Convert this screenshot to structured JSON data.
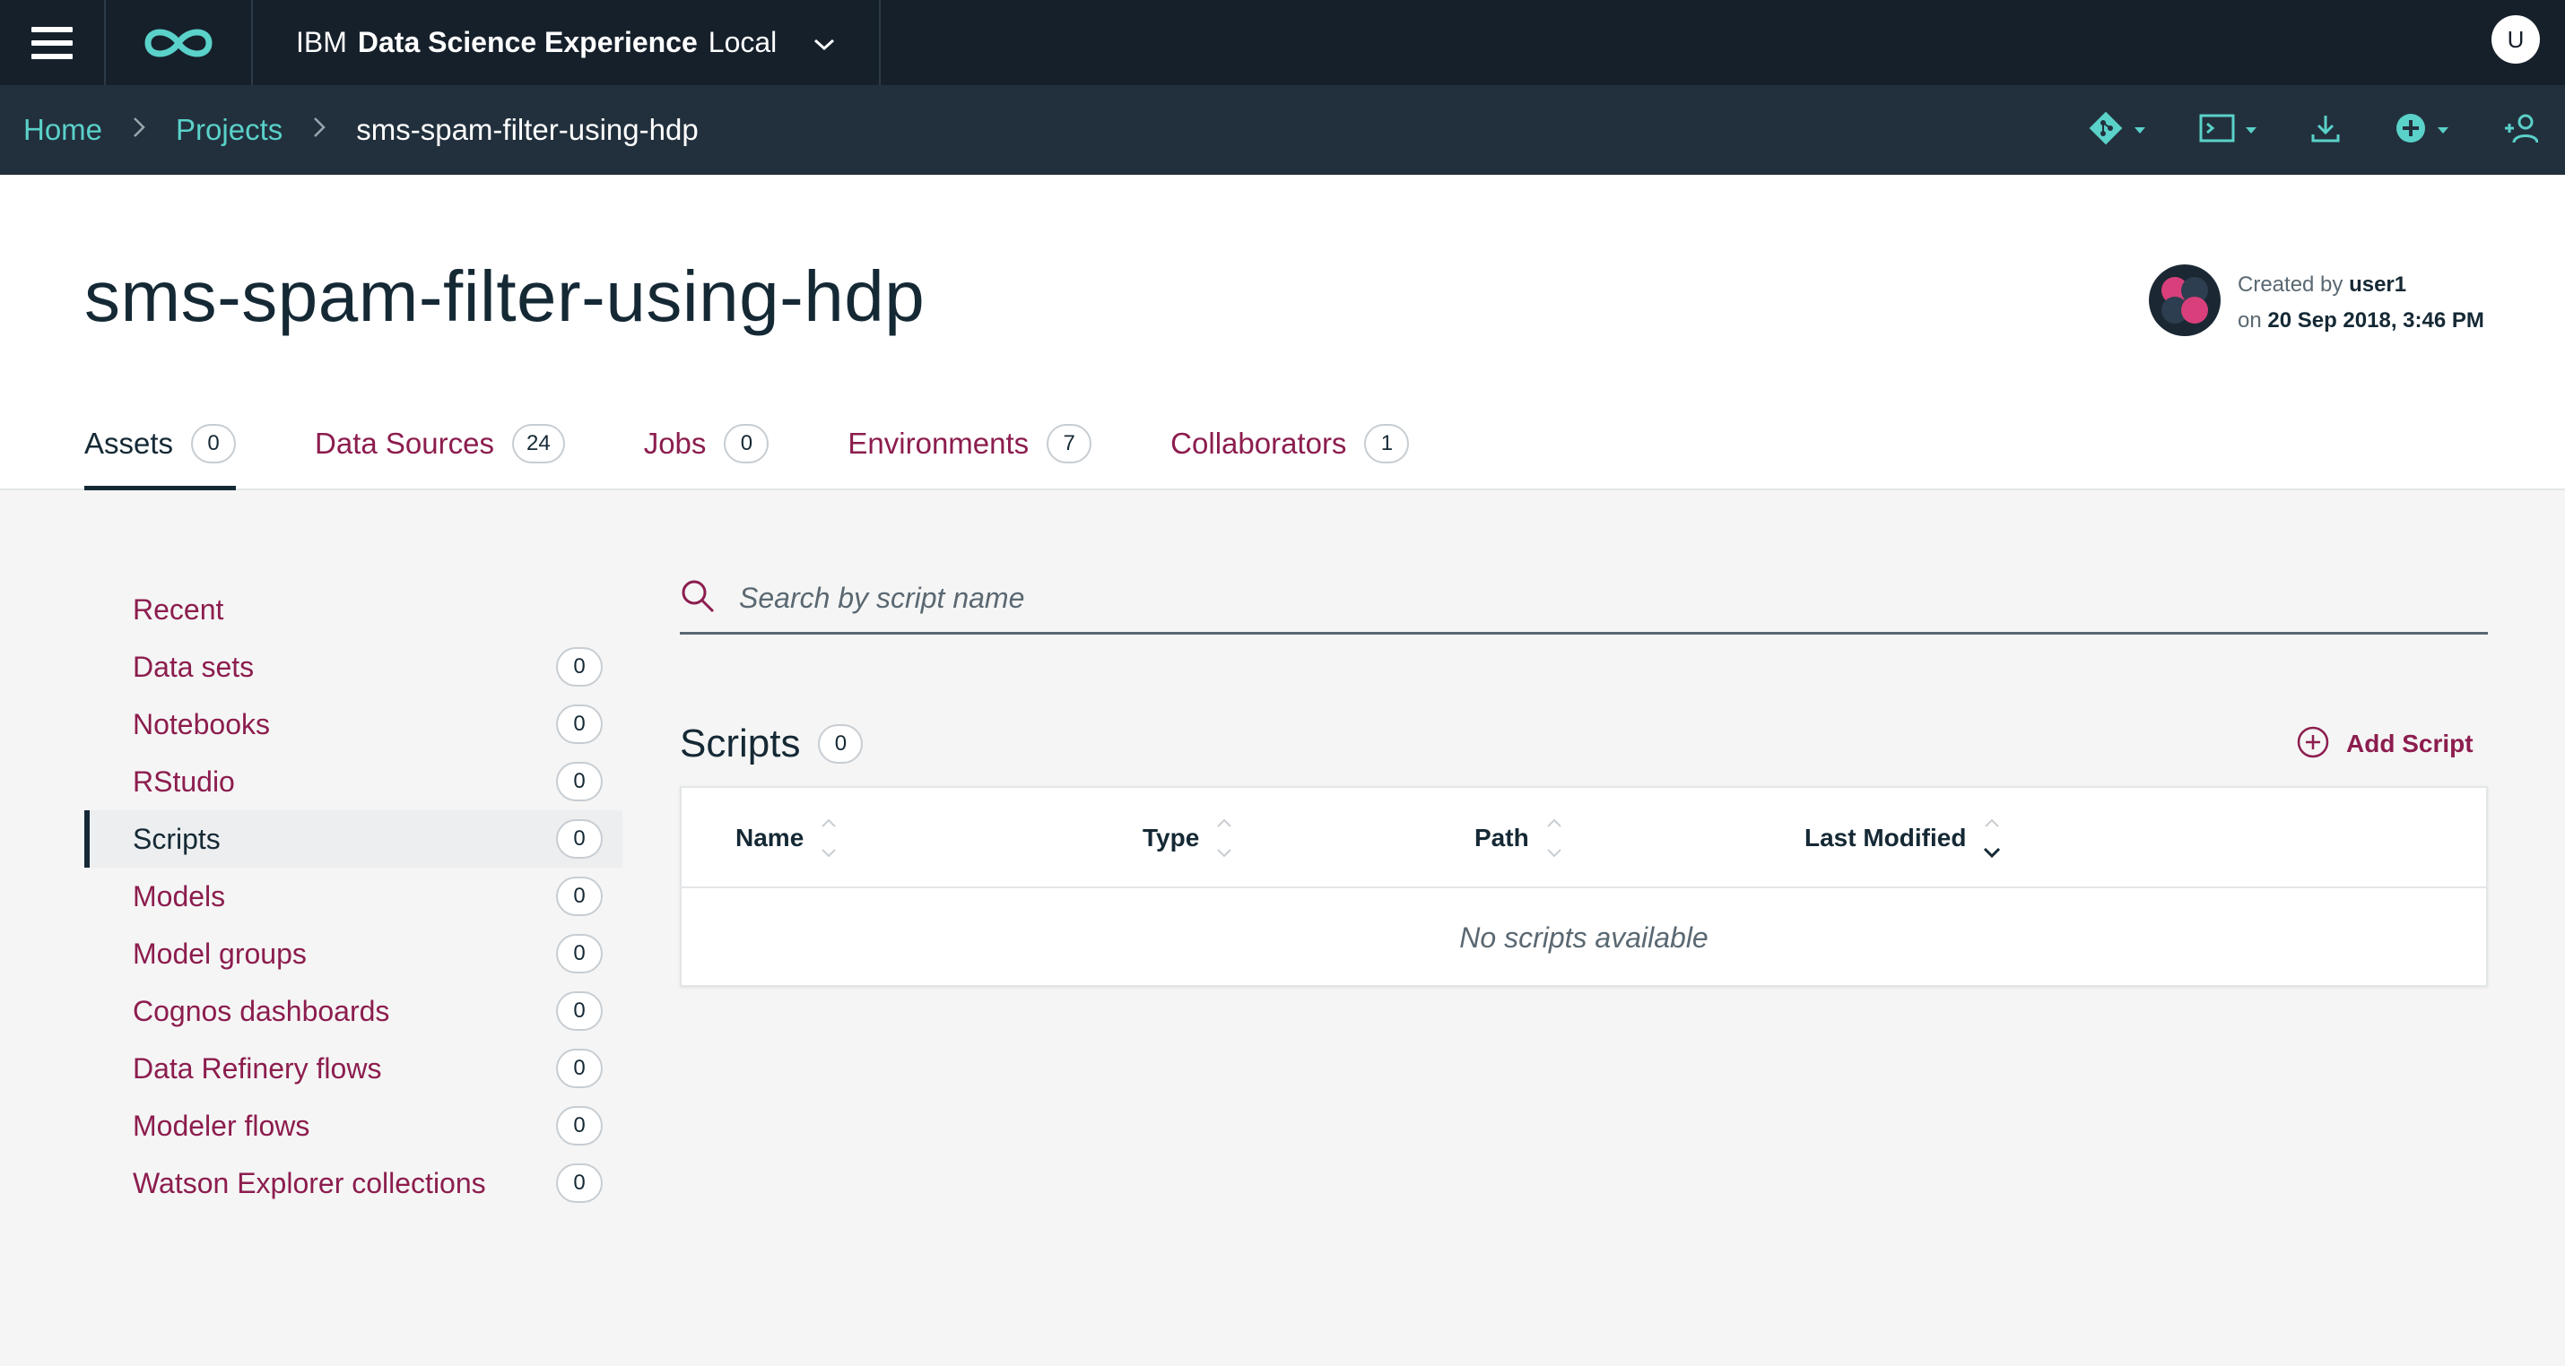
{
  "topbar": {
    "brand_ibm": "IBM",
    "brand_product": "Data Science Experience",
    "brand_edition": "Local",
    "user_initial": "U"
  },
  "breadcrumb": {
    "home": "Home",
    "projects": "Projects",
    "current": "sms-spam-filter-using-hdp"
  },
  "project": {
    "title": "sms-spam-filter-using-hdp",
    "created_by_label": "Created by",
    "created_by_user": "user1",
    "on_label": "on",
    "created_on": "20 Sep 2018, 3:46 PM"
  },
  "tabs": [
    {
      "label": "Assets",
      "count": "0"
    },
    {
      "label": "Data Sources",
      "count": "24"
    },
    {
      "label": "Jobs",
      "count": "0"
    },
    {
      "label": "Environments",
      "count": "7"
    },
    {
      "label": "Collaborators",
      "count": "1"
    }
  ],
  "sidebar": {
    "items": [
      {
        "label": "Recent"
      },
      {
        "label": "Data sets",
        "count": "0"
      },
      {
        "label": "Notebooks",
        "count": "0"
      },
      {
        "label": "RStudio",
        "count": "0"
      },
      {
        "label": "Scripts",
        "count": "0"
      },
      {
        "label": "Models",
        "count": "0"
      },
      {
        "label": "Model groups",
        "count": "0"
      },
      {
        "label": "Cognos dashboards",
        "count": "0"
      },
      {
        "label": "Data Refinery flows",
        "count": "0"
      },
      {
        "label": "Modeler flows",
        "count": "0"
      },
      {
        "label": "Watson Explorer collections",
        "count": "0"
      }
    ]
  },
  "search": {
    "placeholder": "Search by script name"
  },
  "scripts": {
    "title": "Scripts",
    "count": "0",
    "add_label": "Add Script",
    "columns": [
      "Name",
      "Type",
      "Path",
      "Last Modified"
    ],
    "empty_message": "No scripts available"
  },
  "colors": {
    "topbar": "#16202b",
    "crumbbar": "#22303d",
    "teal_accent": "#5ad1c9",
    "link_magenta": "#8c1d4e"
  }
}
